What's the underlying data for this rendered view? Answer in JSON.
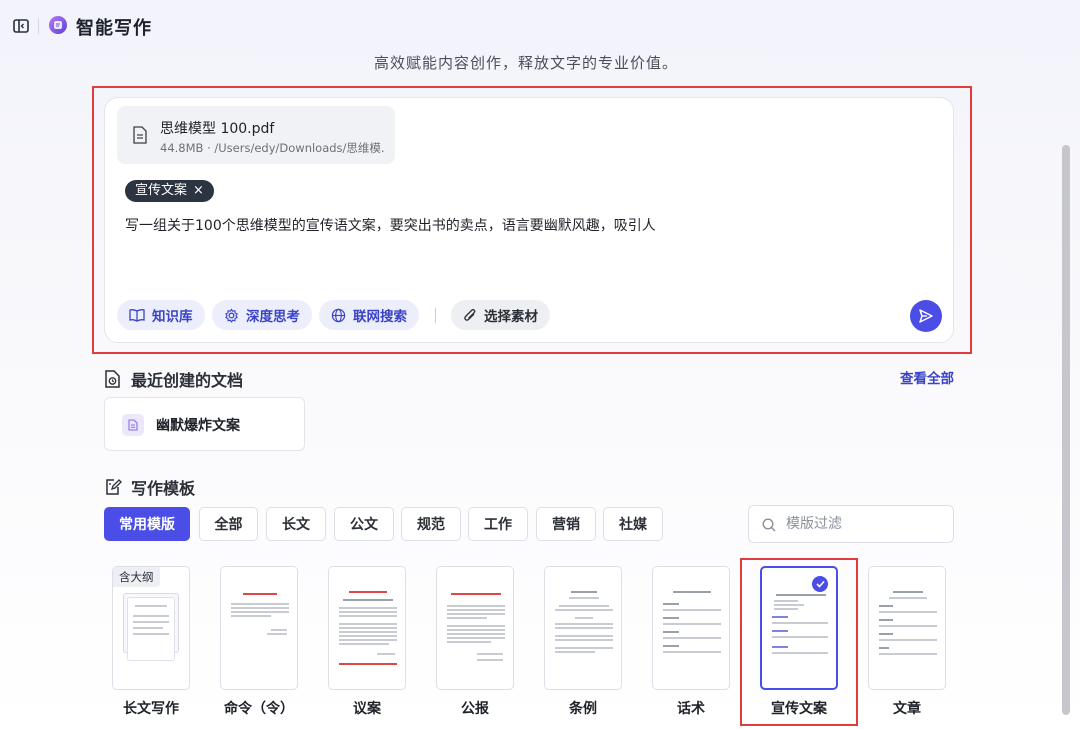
{
  "app": {
    "title": "智能写作",
    "tagline": "高效赋能内容创作，释放文字的专业价值。"
  },
  "composer": {
    "file": {
      "name": "思维模型 100.pdf",
      "meta": "44.8MB · /Users/edy/Downloads/思维模..."
    },
    "tag": {
      "label": "宣传文案",
      "close": "×"
    },
    "prompt": "写一组关于100个思维模型的宣传语文案，要突出书的卖点，语言要幽默风趣，吸引人",
    "tools": {
      "knowledge": "知识库",
      "deep": "深度思考",
      "web": "联网搜索",
      "material": "选择素材"
    }
  },
  "recent": {
    "title": "最近创建的文档",
    "view_all": "查看全部",
    "items": [
      "幽默爆炸文案"
    ]
  },
  "templates": {
    "title": "写作模板",
    "tabs": [
      "常用模版",
      "全部",
      "长文",
      "公文",
      "规范",
      "工作",
      "营销",
      "社媒"
    ],
    "search_placeholder": "模版过滤",
    "badge": "含大纲",
    "items": [
      {
        "label": "长文写作"
      },
      {
        "label": "命令（令）"
      },
      {
        "label": "议案"
      },
      {
        "label": "公报"
      },
      {
        "label": "条例"
      },
      {
        "label": "话术"
      },
      {
        "label": "宣传文案"
      },
      {
        "label": "文章"
      }
    ]
  },
  "colors": {
    "accent": "#4a4ee6",
    "highlight": "#e03c3c",
    "tag_bg": "#2c3442"
  }
}
